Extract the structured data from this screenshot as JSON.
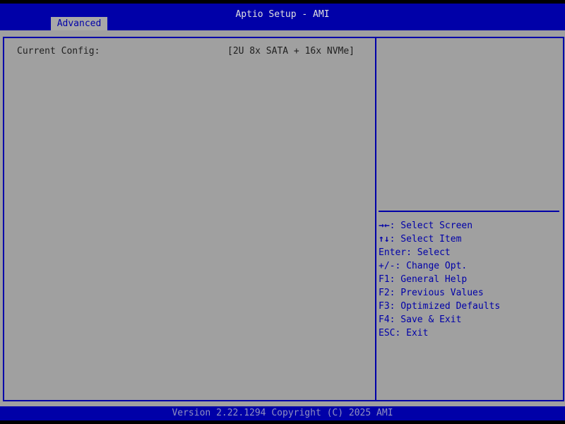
{
  "header": {
    "title": "Aptio Setup - AMI",
    "tabs": [
      {
        "label": "Advanced",
        "active": true
      }
    ]
  },
  "main": {
    "items": [
      {
        "label": "Current Config:",
        "value": "[2U 8x SATA + 16x NVMe]"
      }
    ]
  },
  "help": [
    {
      "key": "→←",
      "text": ": Select Screen"
    },
    {
      "key": "↑↓",
      "text": ": Select Item"
    },
    {
      "key": "",
      "text": "Enter: Select"
    },
    {
      "key": "",
      "text": "+/-: Change Opt."
    },
    {
      "key": "",
      "text": "F1: General Help"
    },
    {
      "key": "",
      "text": "F2: Previous Values"
    },
    {
      "key": "",
      "text": "F3: Optimized Defaults"
    },
    {
      "key": "",
      "text": "F4: Save & Exit"
    },
    {
      "key": "",
      "text": "ESC: Exit"
    }
  ],
  "footer": {
    "text": "Version 2.22.1294 Copyright (C) 2025 AMI"
  },
  "colors": {
    "blue": "#0000a8",
    "gray": "#a0a0a0"
  }
}
